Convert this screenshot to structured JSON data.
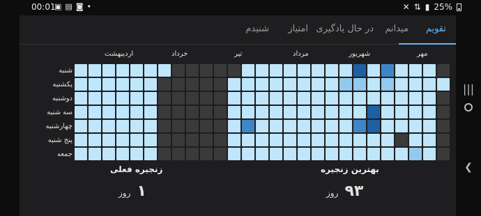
{
  "statusbar": {
    "time": "00:01",
    "battery": "25%",
    "icons": [
      "gallery-icon",
      "message-icon",
      "instagram-icon",
      "dot-icon"
    ],
    "right_icons": [
      "mute-icon",
      "data-icon",
      "signal-icon"
    ]
  },
  "tabs": [
    {
      "label": "تقویم",
      "active": true
    },
    {
      "label": "میدانم",
      "active": false
    },
    {
      "label": "در حال یادگیری",
      "active": false
    },
    {
      "label": "امتیاز",
      "active": false
    },
    {
      "label": "شنیدم",
      "active": false
    }
  ],
  "calendar": {
    "months": [
      "مهر",
      "شهریور",
      "مرداد",
      "تیر",
      "خرداد",
      "اردیبهشت"
    ],
    "days": [
      "شنبه",
      "یکشنبه",
      "دوشنبه",
      "سه شنبه",
      "چهارشنبه",
      "پنج شنبه",
      "جمعه"
    ],
    "weeks": 27,
    "colors": {
      "empty": "#3a3a3a",
      "level1": "#bfe6fb",
      "level2": "#93c9ee",
      "level3": "#3f86c6",
      "level4": "#1f5fa3"
    },
    "levels": [
      [
        1,
        1,
        1,
        1,
        1,
        1,
        1
      ],
      [
        1,
        1,
        1,
        1,
        1,
        1,
        1
      ],
      [
        1,
        1,
        1,
        1,
        1,
        1,
        1
      ],
      [
        1,
        1,
        1,
        1,
        1,
        1,
        1
      ],
      [
        1,
        1,
        1,
        1,
        1,
        1,
        1
      ],
      [
        1,
        1,
        1,
        1,
        1,
        1,
        1
      ],
      [
        1,
        0,
        0,
        0,
        0,
        0,
        0
      ],
      [
        0,
        0,
        0,
        0,
        0,
        0,
        0
      ],
      [
        0,
        0,
        0,
        0,
        0,
        0,
        0
      ],
      [
        0,
        0,
        0,
        0,
        0,
        0,
        0
      ],
      [
        0,
        0,
        0,
        0,
        0,
        0,
        0
      ],
      [
        0,
        1,
        1,
        1,
        1,
        1,
        1
      ],
      [
        1,
        1,
        1,
        1,
        3,
        1,
        1
      ],
      [
        1,
        1,
        1,
        1,
        1,
        1,
        1
      ],
      [
        1,
        1,
        1,
        1,
        1,
        1,
        1
      ],
      [
        1,
        1,
        1,
        1,
        1,
        1,
        1
      ],
      [
        1,
        1,
        1,
        1,
        1,
        1,
        1
      ],
      [
        1,
        1,
        1,
        1,
        1,
        1,
        1
      ],
      [
        1,
        1,
        1,
        1,
        1,
        1,
        1
      ],
      [
        1,
        2,
        1,
        1,
        1,
        1,
        1
      ],
      [
        4,
        2,
        1,
        1,
        3,
        1,
        1
      ],
      [
        1,
        1,
        1,
        4,
        4,
        1,
        1
      ],
      [
        3,
        2,
        1,
        1,
        1,
        1,
        1
      ],
      [
        1,
        1,
        1,
        1,
        1,
        0,
        1
      ],
      [
        1,
        1,
        1,
        1,
        1,
        1,
        2
      ],
      [
        1,
        1,
        1,
        1,
        1,
        1,
        1
      ],
      [
        0,
        1,
        0,
        0,
        0,
        0,
        0
      ]
    ]
  },
  "stats": {
    "current_title": "زنجیره فعلی",
    "current_value": "۱",
    "current_unit": "روز",
    "best_title": "بهترین زنجیره",
    "best_value": "۹۳",
    "best_unit": "روز"
  },
  "nav": {
    "recents": "|||",
    "back": "❮"
  }
}
